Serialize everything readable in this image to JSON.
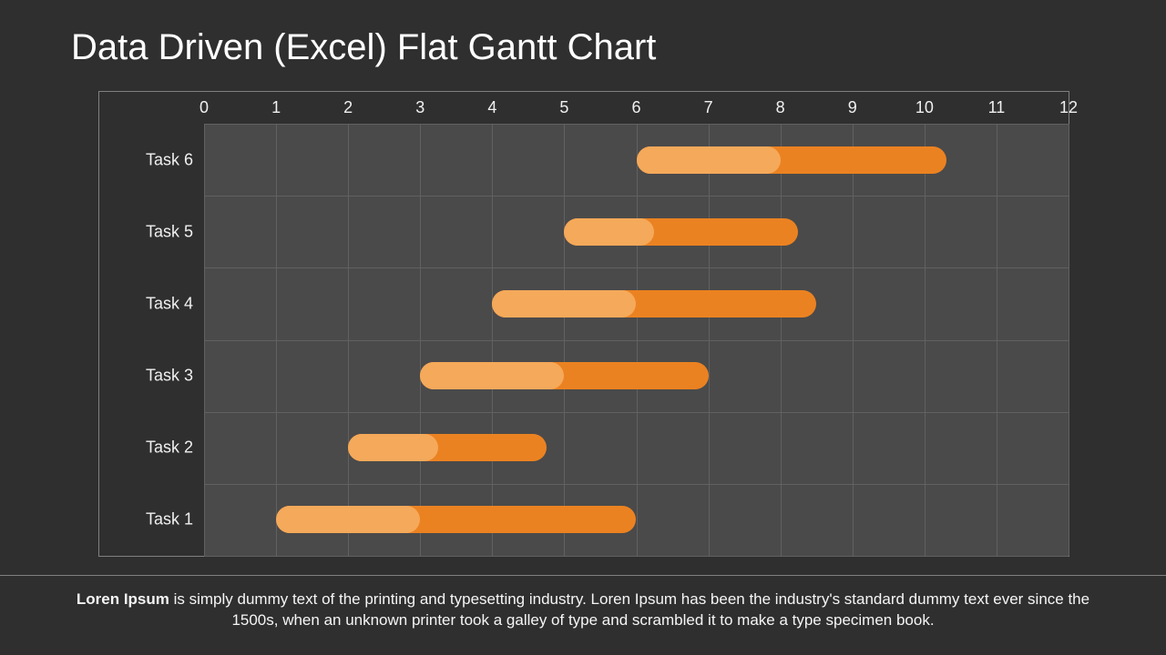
{
  "title": "Data Driven (Excel) Flat Gantt Chart",
  "footer_bold": "Loren Ipsum",
  "footer_rest": " is simply dummy text of the printing and typesetting industry. Loren Ipsum has been the industry's standard dummy text ever since the 1500s, when an unknown printer took a galley of type and scrambled it to make a type specimen book.",
  "chart_data": {
    "type": "bar",
    "title": "",
    "xlabel": "",
    "ylabel": "",
    "xlim": [
      0,
      12
    ],
    "x_ticks": [
      0,
      1,
      2,
      3,
      4,
      5,
      6,
      7,
      8,
      9,
      10,
      11,
      12
    ],
    "categories": [
      "Task 6",
      "Task 5",
      "Task 4",
      "Task 3",
      "Task 2",
      "Task 1"
    ],
    "series": [
      {
        "name": "offset",
        "role": "spacer",
        "values": [
          6.0,
          5.0,
          4.0,
          3.0,
          2.0,
          1.0
        ]
      },
      {
        "name": "progress",
        "color": "#f5a95a",
        "values": [
          2.0,
          1.25,
          2.0,
          2.0,
          1.25,
          2.0
        ]
      },
      {
        "name": "remaining",
        "color": "#eb8221",
        "values": [
          2.3,
          2.0,
          2.5,
          2.0,
          1.5,
          3.0
        ]
      }
    ],
    "colors": {
      "plot_bg": "#4a4a4a",
      "grid": "#616161",
      "progress": "#f5a95a",
      "remaining": "#eb8221"
    }
  }
}
